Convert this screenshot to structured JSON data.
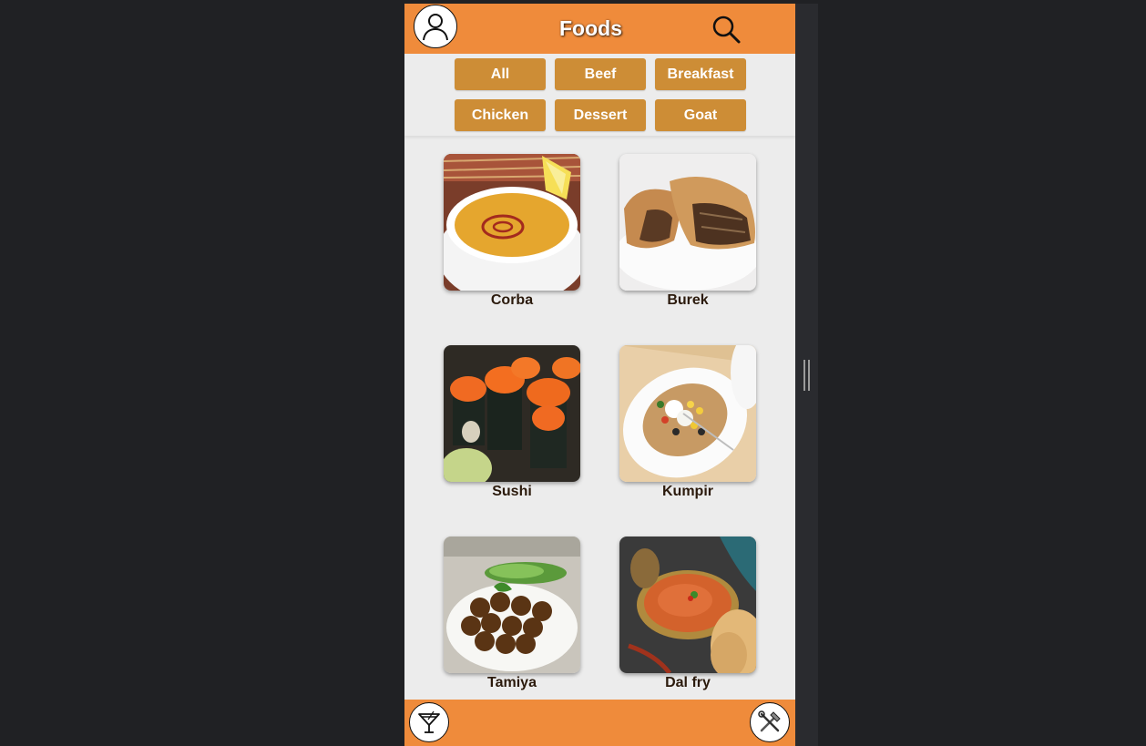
{
  "app": {
    "title": "Foods",
    "accent_color": "#ef8b3b",
    "filter_color": "#cd8d36"
  },
  "header": {
    "profile_icon": "user-icon",
    "search_icon": "search-icon"
  },
  "filters": [
    {
      "label": "All"
    },
    {
      "label": "Beef"
    },
    {
      "label": "Breakfast"
    },
    {
      "label": "Chicken"
    },
    {
      "label": "Dessert"
    },
    {
      "label": "Goat"
    }
  ],
  "foods": [
    {
      "name": "Corba"
    },
    {
      "name": "Burek"
    },
    {
      "name": "Sushi"
    },
    {
      "name": "Kumpir"
    },
    {
      "name": "Tamiya"
    },
    {
      "name": "Dal fry"
    }
  ],
  "footer": {
    "left_icon": "cocktail-icon",
    "right_icon": "tools-icon"
  }
}
